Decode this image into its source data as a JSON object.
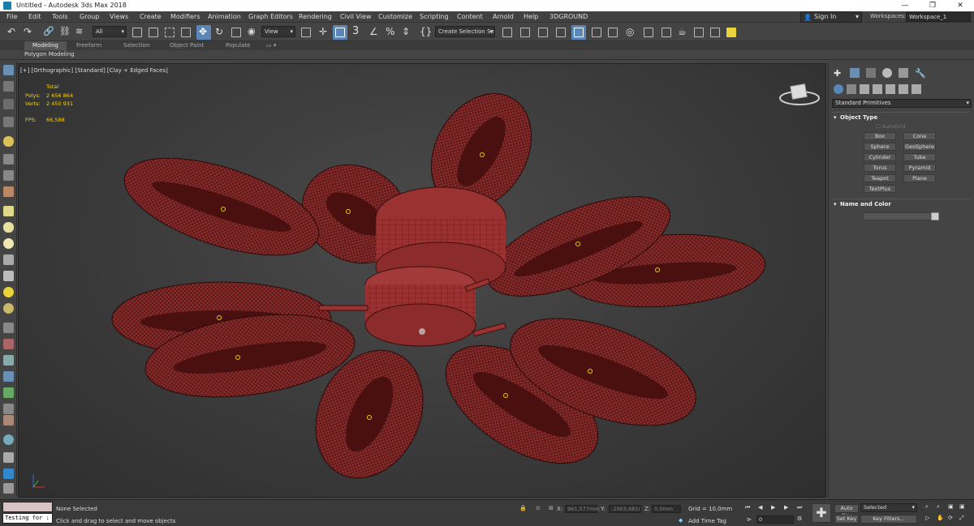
{
  "app": {
    "title": "Untitled - Autodesk 3ds Max 2018"
  },
  "menu": {
    "items": [
      "File",
      "Edit",
      "Tools",
      "Group",
      "Views",
      "Create",
      "Modifiers",
      "Animation",
      "Graph Editors",
      "Rendering",
      "Civil View",
      "Customize",
      "Scripting",
      "Content",
      "Arnold",
      "Help",
      "3DGROUND"
    ]
  },
  "account": {
    "signin": "Sign In",
    "workspaces_label": "Workspaces:",
    "workspace": "Workspace_1"
  },
  "toolbar": {
    "filter": "All",
    "ref_coord": "View",
    "selection_set": "Create Selection Se"
  },
  "ribbon": {
    "tabs": [
      "Modeling",
      "Freeform",
      "Selection",
      "Object Paint",
      "Populate"
    ],
    "active_tab": "Modeling",
    "sub_label": "Polygon Modeling"
  },
  "viewport": {
    "label": "[+] [Orthographic] [Standard] [Clay + Edged Faces]",
    "stats_total": "Total",
    "polys_label": "Polys:",
    "polys_value": "2 656 864",
    "verts_label": "Verts:",
    "verts_value": "2 450 931",
    "fps_label": "FPS:",
    "fps_value": "66,588",
    "mesh_color": "#8b2b2b"
  },
  "command_panel": {
    "dropdown": "Standard Primitives",
    "object_type_header": "Object Type",
    "autogrid": "AutoGrid",
    "buttons": [
      "Box",
      "Cone",
      "Sphere",
      "GeoSphere",
      "Cylinder",
      "Tube",
      "Torus",
      "Pyramid",
      "Teapot",
      "Plane",
      "TextPlus"
    ],
    "name_color_header": "Name and Color"
  },
  "status": {
    "maxscript_input": "Testing for :",
    "selection_info": "None Selected",
    "prompt": "Click and drag to select and move objects",
    "x_label": "X:",
    "x_value": "961,577mm",
    "y_label": "Y:",
    "y_value": "-2003,681r",
    "z_label": "Z:",
    "z_value": "0,0mm",
    "grid": "Grid = 10,0mm",
    "add_time_tag": "Add Time Tag",
    "frame": "0",
    "auto_key": "Auto Key",
    "set_key": "Set Key",
    "key_selection": "Selected",
    "key_filters": "Key Filters..."
  }
}
